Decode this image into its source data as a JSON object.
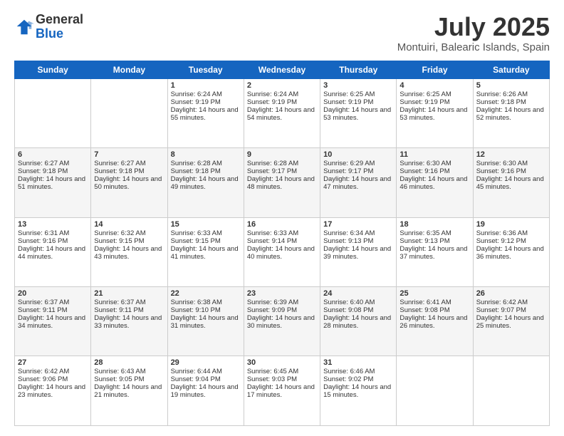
{
  "logo": {
    "general": "General",
    "blue": "Blue"
  },
  "title": "July 2025",
  "location": "Montuiri, Balearic Islands, Spain",
  "days_of_week": [
    "Sunday",
    "Monday",
    "Tuesday",
    "Wednesday",
    "Thursday",
    "Friday",
    "Saturday"
  ],
  "weeks": [
    [
      {
        "day": "",
        "sunrise": "",
        "sunset": "",
        "daylight": ""
      },
      {
        "day": "",
        "sunrise": "",
        "sunset": "",
        "daylight": ""
      },
      {
        "day": "1",
        "sunrise": "Sunrise: 6:24 AM",
        "sunset": "Sunset: 9:19 PM",
        "daylight": "Daylight: 14 hours and 55 minutes."
      },
      {
        "day": "2",
        "sunrise": "Sunrise: 6:24 AM",
        "sunset": "Sunset: 9:19 PM",
        "daylight": "Daylight: 14 hours and 54 minutes."
      },
      {
        "day": "3",
        "sunrise": "Sunrise: 6:25 AM",
        "sunset": "Sunset: 9:19 PM",
        "daylight": "Daylight: 14 hours and 53 minutes."
      },
      {
        "day": "4",
        "sunrise": "Sunrise: 6:25 AM",
        "sunset": "Sunset: 9:19 PM",
        "daylight": "Daylight: 14 hours and 53 minutes."
      },
      {
        "day": "5",
        "sunrise": "Sunrise: 6:26 AM",
        "sunset": "Sunset: 9:18 PM",
        "daylight": "Daylight: 14 hours and 52 minutes."
      }
    ],
    [
      {
        "day": "6",
        "sunrise": "Sunrise: 6:27 AM",
        "sunset": "Sunset: 9:18 PM",
        "daylight": "Daylight: 14 hours and 51 minutes."
      },
      {
        "day": "7",
        "sunrise": "Sunrise: 6:27 AM",
        "sunset": "Sunset: 9:18 PM",
        "daylight": "Daylight: 14 hours and 50 minutes."
      },
      {
        "day": "8",
        "sunrise": "Sunrise: 6:28 AM",
        "sunset": "Sunset: 9:18 PM",
        "daylight": "Daylight: 14 hours and 49 minutes."
      },
      {
        "day": "9",
        "sunrise": "Sunrise: 6:28 AM",
        "sunset": "Sunset: 9:17 PM",
        "daylight": "Daylight: 14 hours and 48 minutes."
      },
      {
        "day": "10",
        "sunrise": "Sunrise: 6:29 AM",
        "sunset": "Sunset: 9:17 PM",
        "daylight": "Daylight: 14 hours and 47 minutes."
      },
      {
        "day": "11",
        "sunrise": "Sunrise: 6:30 AM",
        "sunset": "Sunset: 9:16 PM",
        "daylight": "Daylight: 14 hours and 46 minutes."
      },
      {
        "day": "12",
        "sunrise": "Sunrise: 6:30 AM",
        "sunset": "Sunset: 9:16 PM",
        "daylight": "Daylight: 14 hours and 45 minutes."
      }
    ],
    [
      {
        "day": "13",
        "sunrise": "Sunrise: 6:31 AM",
        "sunset": "Sunset: 9:16 PM",
        "daylight": "Daylight: 14 hours and 44 minutes."
      },
      {
        "day": "14",
        "sunrise": "Sunrise: 6:32 AM",
        "sunset": "Sunset: 9:15 PM",
        "daylight": "Daylight: 14 hours and 43 minutes."
      },
      {
        "day": "15",
        "sunrise": "Sunrise: 6:33 AM",
        "sunset": "Sunset: 9:15 PM",
        "daylight": "Daylight: 14 hours and 41 minutes."
      },
      {
        "day": "16",
        "sunrise": "Sunrise: 6:33 AM",
        "sunset": "Sunset: 9:14 PM",
        "daylight": "Daylight: 14 hours and 40 minutes."
      },
      {
        "day": "17",
        "sunrise": "Sunrise: 6:34 AM",
        "sunset": "Sunset: 9:13 PM",
        "daylight": "Daylight: 14 hours and 39 minutes."
      },
      {
        "day": "18",
        "sunrise": "Sunrise: 6:35 AM",
        "sunset": "Sunset: 9:13 PM",
        "daylight": "Daylight: 14 hours and 37 minutes."
      },
      {
        "day": "19",
        "sunrise": "Sunrise: 6:36 AM",
        "sunset": "Sunset: 9:12 PM",
        "daylight": "Daylight: 14 hours and 36 minutes."
      }
    ],
    [
      {
        "day": "20",
        "sunrise": "Sunrise: 6:37 AM",
        "sunset": "Sunset: 9:11 PM",
        "daylight": "Daylight: 14 hours and 34 minutes."
      },
      {
        "day": "21",
        "sunrise": "Sunrise: 6:37 AM",
        "sunset": "Sunset: 9:11 PM",
        "daylight": "Daylight: 14 hours and 33 minutes."
      },
      {
        "day": "22",
        "sunrise": "Sunrise: 6:38 AM",
        "sunset": "Sunset: 9:10 PM",
        "daylight": "Daylight: 14 hours and 31 minutes."
      },
      {
        "day": "23",
        "sunrise": "Sunrise: 6:39 AM",
        "sunset": "Sunset: 9:09 PM",
        "daylight": "Daylight: 14 hours and 30 minutes."
      },
      {
        "day": "24",
        "sunrise": "Sunrise: 6:40 AM",
        "sunset": "Sunset: 9:08 PM",
        "daylight": "Daylight: 14 hours and 28 minutes."
      },
      {
        "day": "25",
        "sunrise": "Sunrise: 6:41 AM",
        "sunset": "Sunset: 9:08 PM",
        "daylight": "Daylight: 14 hours and 26 minutes."
      },
      {
        "day": "26",
        "sunrise": "Sunrise: 6:42 AM",
        "sunset": "Sunset: 9:07 PM",
        "daylight": "Daylight: 14 hours and 25 minutes."
      }
    ],
    [
      {
        "day": "27",
        "sunrise": "Sunrise: 6:42 AM",
        "sunset": "Sunset: 9:06 PM",
        "daylight": "Daylight: 14 hours and 23 minutes."
      },
      {
        "day": "28",
        "sunrise": "Sunrise: 6:43 AM",
        "sunset": "Sunset: 9:05 PM",
        "daylight": "Daylight: 14 hours and 21 minutes."
      },
      {
        "day": "29",
        "sunrise": "Sunrise: 6:44 AM",
        "sunset": "Sunset: 9:04 PM",
        "daylight": "Daylight: 14 hours and 19 minutes."
      },
      {
        "day": "30",
        "sunrise": "Sunrise: 6:45 AM",
        "sunset": "Sunset: 9:03 PM",
        "daylight": "Daylight: 14 hours and 17 minutes."
      },
      {
        "day": "31",
        "sunrise": "Sunrise: 6:46 AM",
        "sunset": "Sunset: 9:02 PM",
        "daylight": "Daylight: 14 hours and 15 minutes."
      },
      {
        "day": "",
        "sunrise": "",
        "sunset": "",
        "daylight": ""
      },
      {
        "day": "",
        "sunrise": "",
        "sunset": "",
        "daylight": ""
      }
    ]
  ]
}
